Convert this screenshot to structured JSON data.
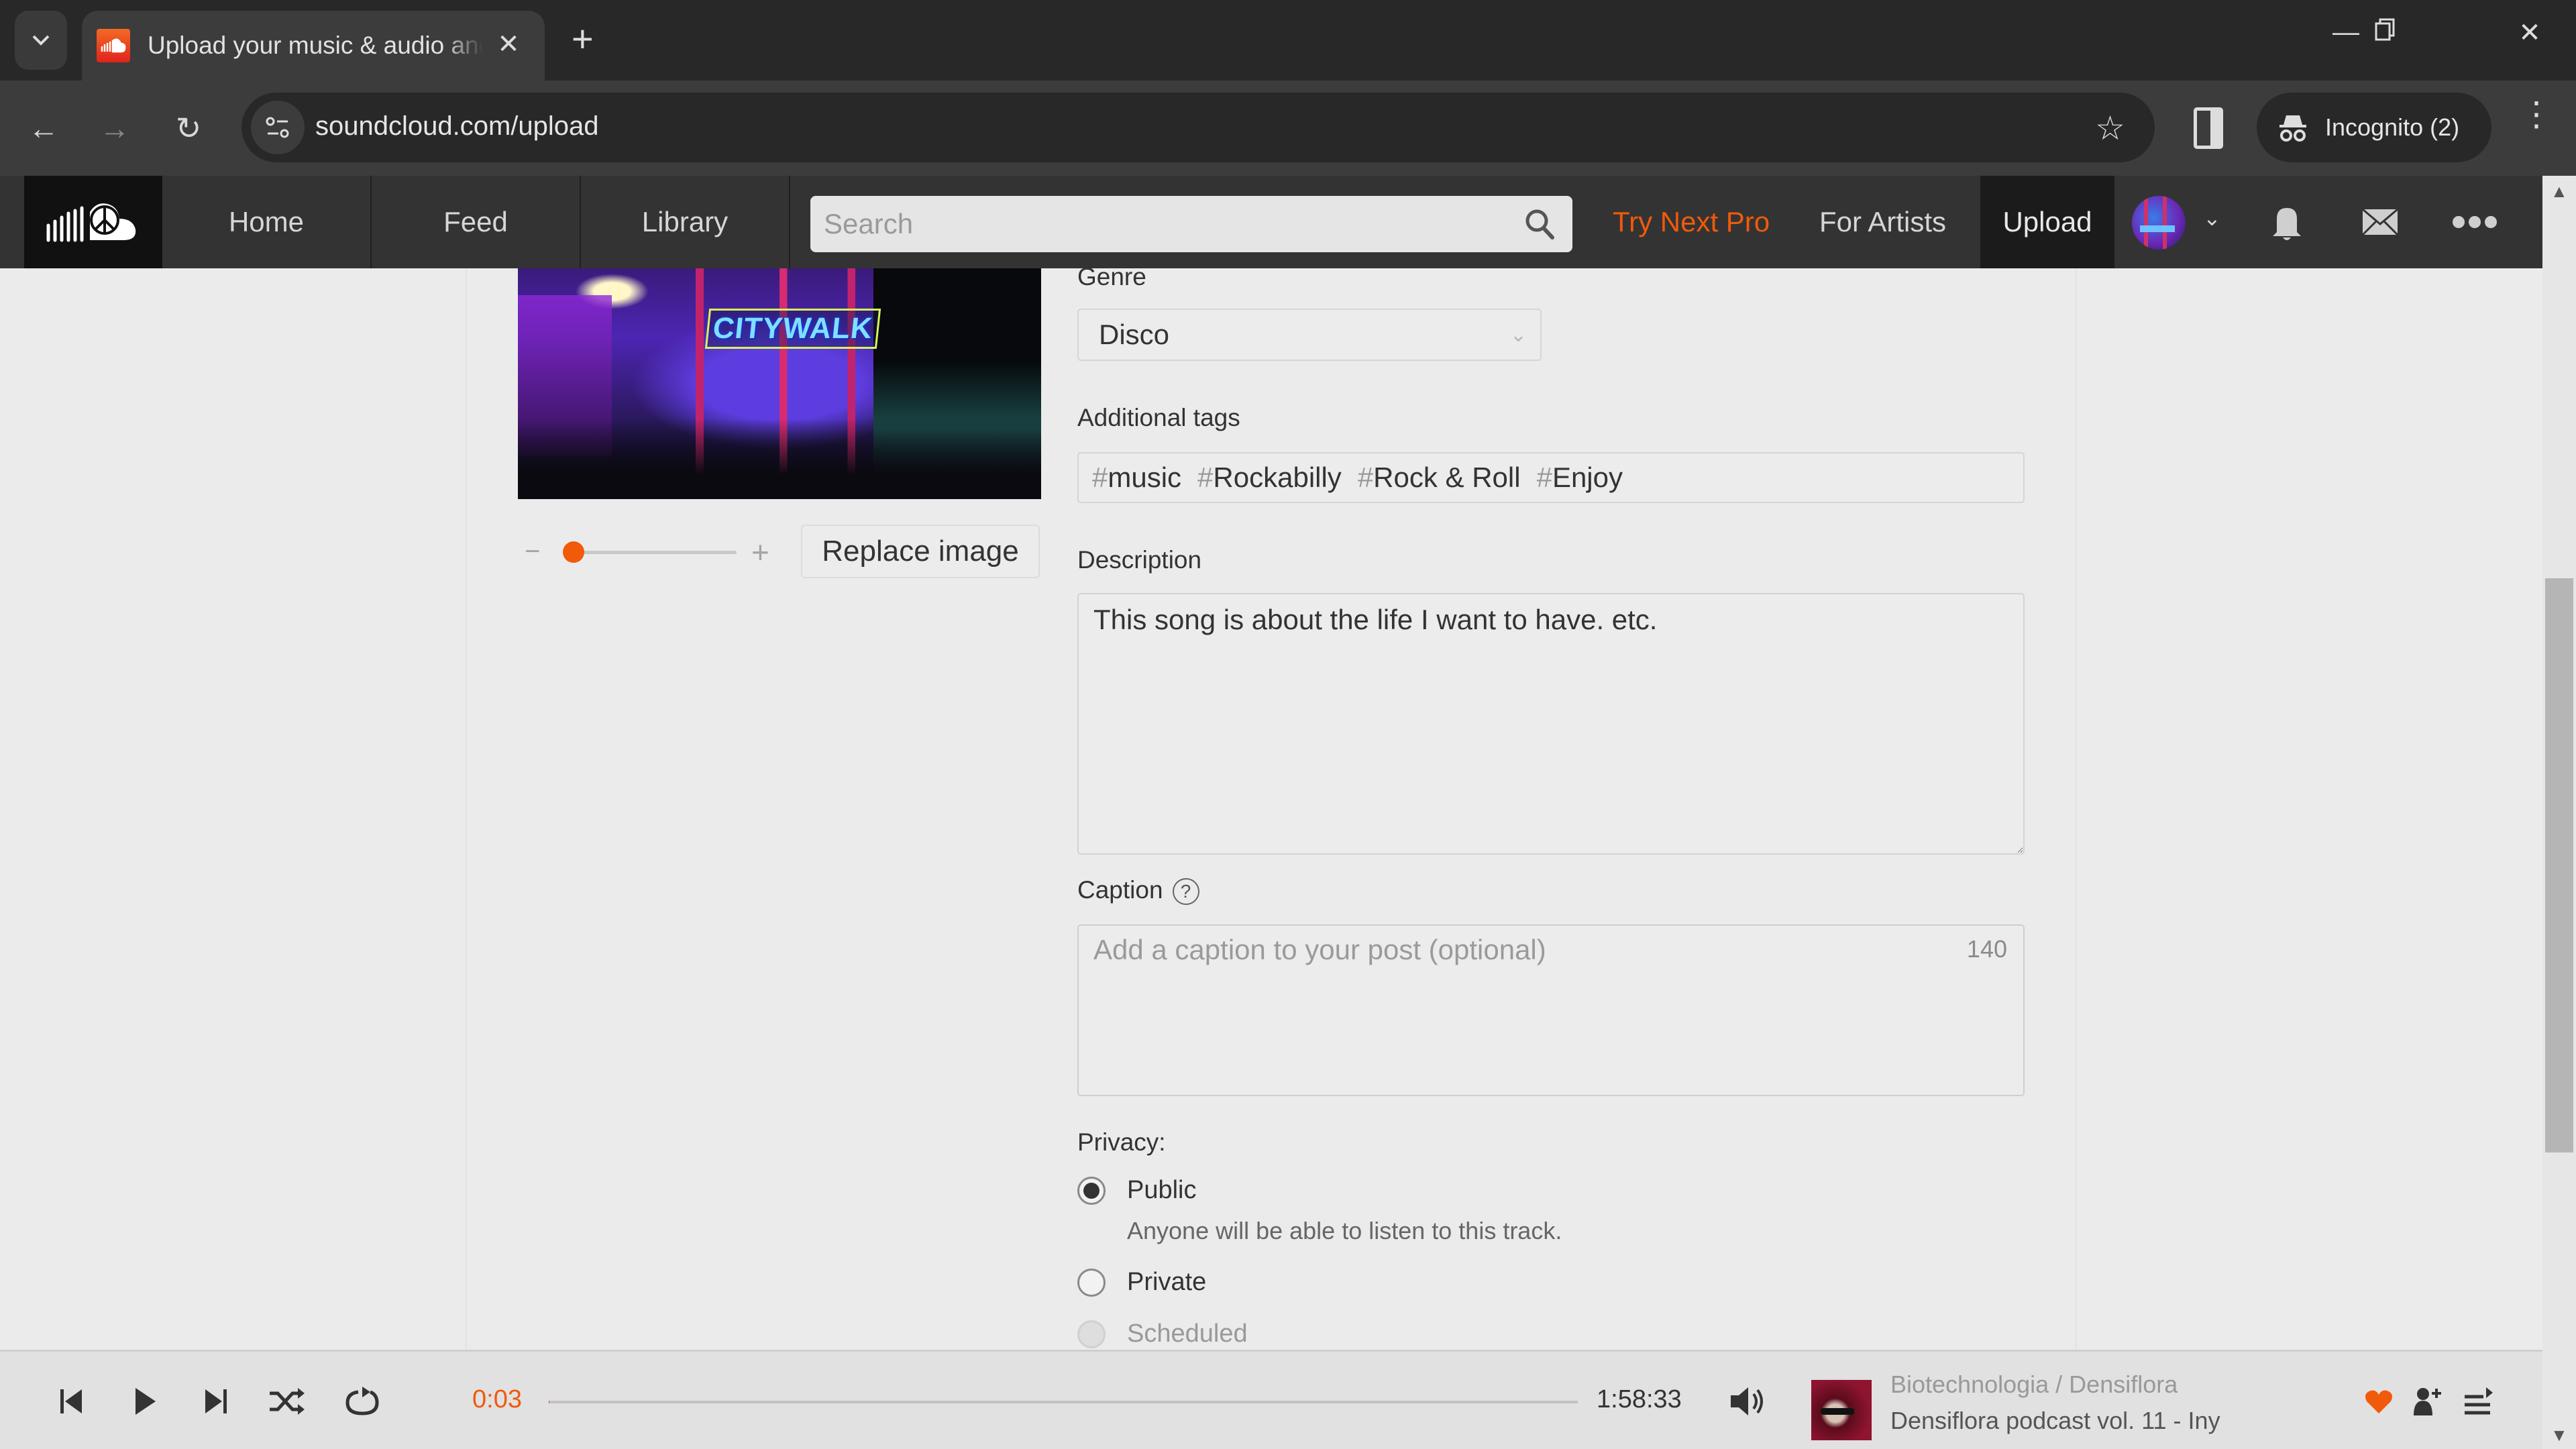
{
  "browser": {
    "tab_title": "Upload your music & audio and share it with the world",
    "url": "soundcloud.com/upload",
    "incognito_label": "Incognito (2)"
  },
  "header": {
    "nav": [
      "Home",
      "Feed",
      "Library"
    ],
    "search_placeholder": "Search",
    "try_pro": "Try Next Pro",
    "for_artists": "For Artists",
    "upload": "Upload"
  },
  "artwork": {
    "sign_text": "CITYWALK",
    "zoom_level": 0.05,
    "replace_label": "Replace image"
  },
  "form": {
    "genre_label": "Genre",
    "genre_value": "Disco",
    "tags_label": "Additional tags",
    "tags": [
      "music",
      "Rockabilly",
      "Rock & Roll",
      "Enjoy"
    ],
    "description_label": "Description",
    "description_value": "This song is about the life I want to have. etc.",
    "caption_label": "Caption",
    "caption_help": "?",
    "caption_placeholder": "Add a caption to your post (optional)",
    "caption_remaining": "140",
    "privacy_label": "Privacy:",
    "privacy_options": [
      {
        "label": "Public",
        "description": "Anyone will be able to listen to this track.",
        "checked": true,
        "disabled": false
      },
      {
        "label": "Private",
        "checked": false,
        "disabled": false
      },
      {
        "label": "Scheduled",
        "checked": false,
        "disabled": true
      }
    ]
  },
  "player": {
    "elapsed": "0:03",
    "duration": "1:58:33",
    "progress": 0.0004,
    "artist": "Biotechnologia / Densiflora",
    "title": "Densiflora podcast vol. 11 - Iny"
  },
  "colors": {
    "accent": "#f05a0a",
    "header_bg": "#333333",
    "page_bg": "#ebebeb"
  }
}
